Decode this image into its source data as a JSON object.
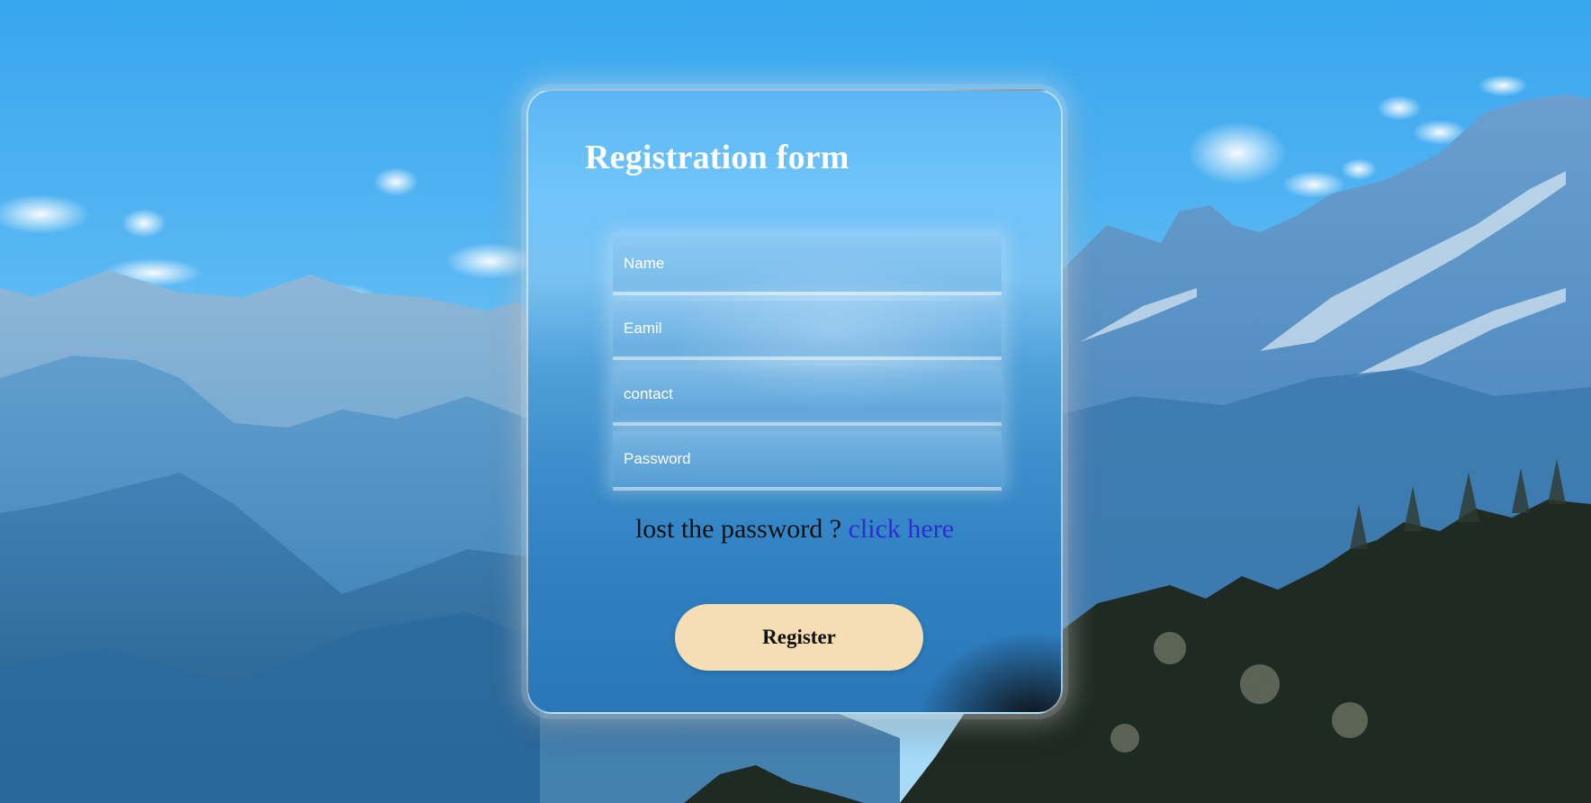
{
  "form": {
    "title": "Registration form",
    "fields": [
      {
        "name": "name",
        "placeholder": "Name"
      },
      {
        "name": "email",
        "placeholder": "Eamil"
      },
      {
        "name": "contact",
        "placeholder": "contact"
      },
      {
        "name": "password",
        "placeholder": "Password"
      }
    ],
    "lost_password_text": "lost the password ?",
    "lost_password_link": "click here",
    "submit_label": "Register"
  },
  "colors": {
    "button_background": "#f5deb3",
    "link": "#2b2fd1",
    "sky": "#3aa8ef"
  }
}
